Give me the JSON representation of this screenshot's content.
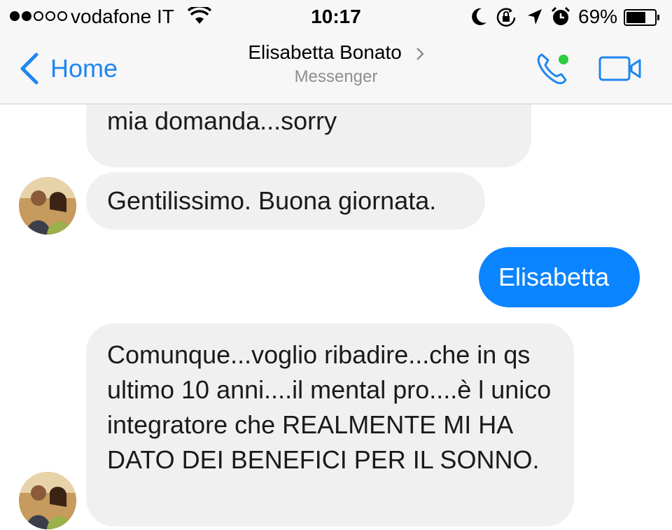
{
  "status_bar": {
    "carrier": "vodafone IT",
    "time": "10:17",
    "battery_percent": "69%",
    "signal_bars_filled": 2,
    "signal_bars_total": 5,
    "battery_level": 0.69,
    "icons": [
      "wifi-icon",
      "moon-icon",
      "rotation-lock-icon",
      "location-arrow-icon",
      "alarm-icon",
      "battery-icon"
    ]
  },
  "header": {
    "back_label": "Home",
    "contact_name": "Elisabetta Bonato",
    "subtitle": "Messenger",
    "accent_color": "#1f86f0",
    "online_color": "#2ecc40"
  },
  "messages": [
    {
      "side": "incoming",
      "text": "Aahh ecco mi ha risposto già alla mia domanda...sorry"
    },
    {
      "side": "incoming",
      "text": "Gentilissimo. Buona giornata."
    },
    {
      "side": "outgoing",
      "text": "Elisabetta"
    },
    {
      "side": "incoming",
      "text": "Comunque...voglio ribadire...che in qs ultimo 10 anni....il mental pro....è l unico integratore che REALMENTE MI HA DATO DEI BENEFICI PER IL SONNO."
    }
  ],
  "colors": {
    "incoming_bubble": "#f1f0f0",
    "outgoing_bubble": "#0b84ff"
  }
}
